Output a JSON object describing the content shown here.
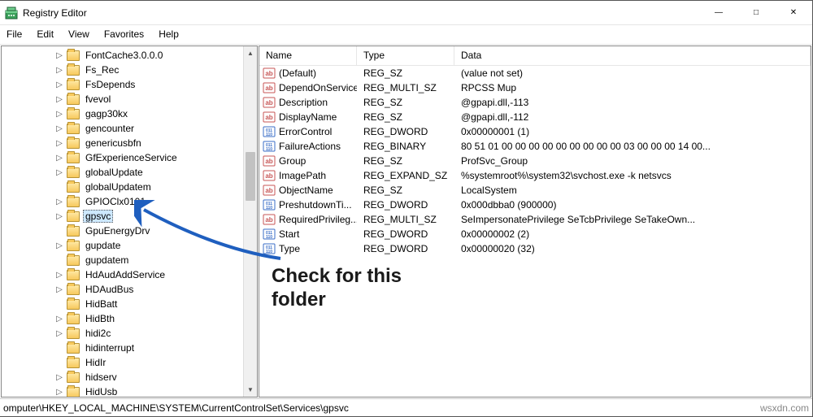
{
  "window": {
    "title": "Registry Editor"
  },
  "menu": {
    "file": "File",
    "edit": "Edit",
    "view": "View",
    "favorites": "Favorites",
    "help": "Help"
  },
  "tree": {
    "items": [
      {
        "label": "FontCache3.0.0.0",
        "exp": true,
        "selected": false
      },
      {
        "label": "Fs_Rec",
        "exp": true,
        "selected": false
      },
      {
        "label": "FsDepends",
        "exp": true,
        "selected": false
      },
      {
        "label": "fvevol",
        "exp": true,
        "selected": false
      },
      {
        "label": "gagp30kx",
        "exp": true,
        "selected": false
      },
      {
        "label": "gencounter",
        "exp": true,
        "selected": false
      },
      {
        "label": "genericusbfn",
        "exp": true,
        "selected": false
      },
      {
        "label": "GfExperienceService",
        "exp": true,
        "selected": false
      },
      {
        "label": "globalUpdate",
        "exp": true,
        "selected": false
      },
      {
        "label": "globalUpdatem",
        "exp": false,
        "selected": false
      },
      {
        "label": "GPIOClx0101",
        "exp": true,
        "selected": false
      },
      {
        "label": "gpsvc",
        "exp": true,
        "selected": true
      },
      {
        "label": "GpuEnergyDrv",
        "exp": false,
        "selected": false
      },
      {
        "label": "gupdate",
        "exp": true,
        "selected": false
      },
      {
        "label": "gupdatem",
        "exp": false,
        "selected": false
      },
      {
        "label": "HdAudAddService",
        "exp": true,
        "selected": false
      },
      {
        "label": "HDAudBus",
        "exp": true,
        "selected": false
      },
      {
        "label": "HidBatt",
        "exp": false,
        "selected": false
      },
      {
        "label": "HidBth",
        "exp": true,
        "selected": false
      },
      {
        "label": "hidi2c",
        "exp": true,
        "selected": false
      },
      {
        "label": "hidinterrupt",
        "exp": false,
        "selected": false
      },
      {
        "label": "HidIr",
        "exp": false,
        "selected": false
      },
      {
        "label": "hidserv",
        "exp": true,
        "selected": false
      },
      {
        "label": "HidUsb",
        "exp": true,
        "selected": false
      }
    ]
  },
  "list": {
    "headers": {
      "name": "Name",
      "type": "Type",
      "data": "Data"
    },
    "rows": [
      {
        "icon": "sz",
        "name": "(Default)",
        "type": "REG_SZ",
        "data": "(value not set)"
      },
      {
        "icon": "sz",
        "name": "DependOnService",
        "type": "REG_MULTI_SZ",
        "data": "RPCSS Mup"
      },
      {
        "icon": "sz",
        "name": "Description",
        "type": "REG_SZ",
        "data": "@gpapi.dll,-113"
      },
      {
        "icon": "sz",
        "name": "DisplayName",
        "type": "REG_SZ",
        "data": "@gpapi.dll,-112"
      },
      {
        "icon": "bin",
        "name": "ErrorControl",
        "type": "REG_DWORD",
        "data": "0x00000001 (1)"
      },
      {
        "icon": "bin",
        "name": "FailureActions",
        "type": "REG_BINARY",
        "data": "80 51 01 00 00 00 00 00 00 00 00 00 03 00 00 00 14 00..."
      },
      {
        "icon": "sz",
        "name": "Group",
        "type": "REG_SZ",
        "data": "ProfSvc_Group"
      },
      {
        "icon": "sz",
        "name": "ImagePath",
        "type": "REG_EXPAND_SZ",
        "data": "%systemroot%\\system32\\svchost.exe -k netsvcs"
      },
      {
        "icon": "sz",
        "name": "ObjectName",
        "type": "REG_SZ",
        "data": "LocalSystem"
      },
      {
        "icon": "bin",
        "name": "PreshutdownTi...",
        "type": "REG_DWORD",
        "data": "0x000dbba0 (900000)"
      },
      {
        "icon": "sz",
        "name": "RequiredPrivileg...",
        "type": "REG_MULTI_SZ",
        "data": "SeImpersonatePrivilege SeTcbPrivilege SeTakeOwn..."
      },
      {
        "icon": "bin",
        "name": "Start",
        "type": "REG_DWORD",
        "data": "0x00000002 (2)"
      },
      {
        "icon": "bin",
        "name": "Type",
        "type": "REG_DWORD",
        "data": "0x00000020 (32)"
      }
    ]
  },
  "status": {
    "path": "omputer\\HKEY_LOCAL_MACHINE\\SYSTEM\\CurrentControlSet\\Services\\gpsvc",
    "watermark": "wsxdn.com"
  },
  "annotation": {
    "line1": "Check for this",
    "line2": "folder"
  }
}
